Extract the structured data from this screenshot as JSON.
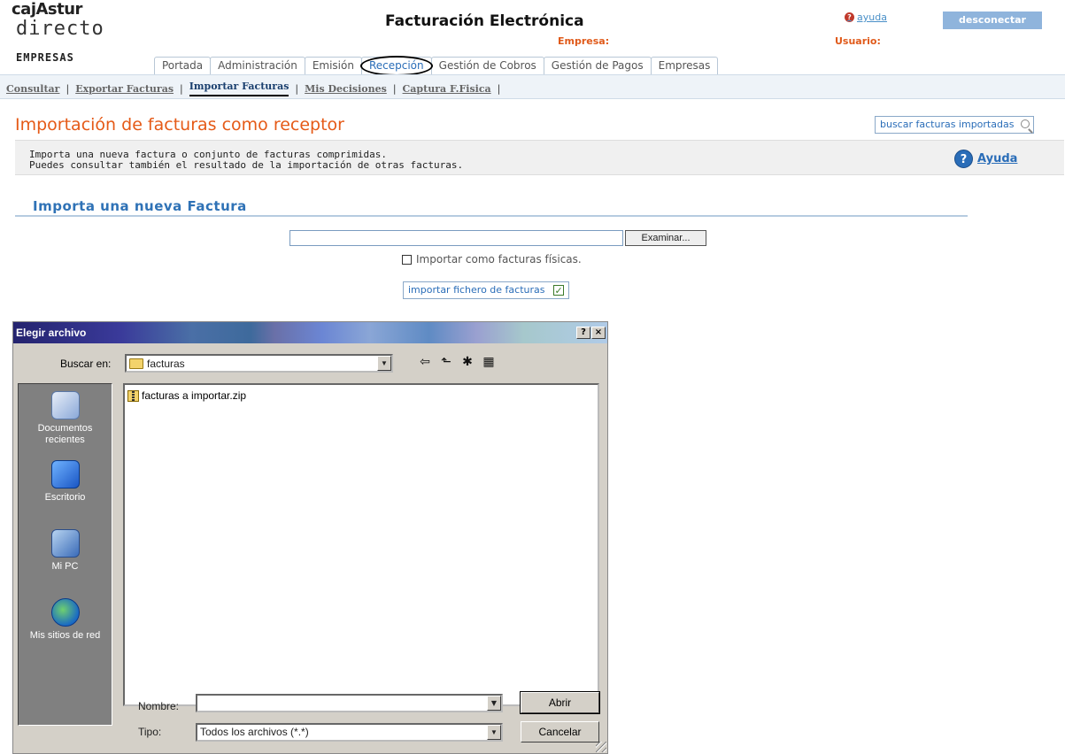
{
  "header": {
    "logo_top": "cajAstur",
    "logo_mid": "directo",
    "logo_bottom": "EMPRESAS",
    "app_title": "Facturación Electrónica",
    "empresa_label": "Empresa:",
    "usuario_label": "Usuario:",
    "help_label": "ayuda",
    "disconnect_label": "desconectar"
  },
  "tabs": [
    {
      "label": "Portada"
    },
    {
      "label": "Administración"
    },
    {
      "label": "Emisión"
    },
    {
      "label": "Recepción",
      "active": true
    },
    {
      "label": "Gestión de Cobros"
    },
    {
      "label": "Gestión de Pagos"
    },
    {
      "label": "Empresas"
    }
  ],
  "subnav": [
    {
      "label": "Consultar"
    },
    {
      "label": "Exportar Facturas"
    },
    {
      "label": "Importar Facturas",
      "active": true
    },
    {
      "label": "Mis Decisiones"
    },
    {
      "label": "Captura F.Fisica"
    }
  ],
  "main": {
    "page_title": "Importación de facturas como receptor",
    "search_imported_label": "buscar facturas importadas",
    "info_line_1": "Importa una nueva factura o conjunto de facturas comprimidas.",
    "info_line_2": "Puedes consultar también el resultado de la importación de otras facturas.",
    "ayuda_label": "Ayuda",
    "section_title": "Importa una nueva Factura",
    "file_input_value": "",
    "browse_label": "Examinar...",
    "checkbox_label": "Importar como facturas físicas.",
    "import_button_label": "importar fichero de facturas"
  },
  "dialog": {
    "title": "Elegir archivo",
    "help_btn": "?",
    "close_btn": "×",
    "look_in_label": "Buscar en:",
    "look_in_value": "facturas",
    "places": [
      {
        "label_1": "Documentos",
        "label_2": "recientes",
        "icon": "recent-documents-icon"
      },
      {
        "label_1": "Escritorio",
        "label_2": "",
        "icon": "desktop-icon"
      },
      {
        "label_1": "Mi PC",
        "label_2": "",
        "icon": "my-computer-icon"
      },
      {
        "label_1": "Mis sitios de red",
        "label_2": "",
        "icon": "network-places-icon"
      }
    ],
    "files": [
      {
        "name": "facturas a importar.zip",
        "icon": "zip-folder-icon"
      }
    ],
    "name_label": "Nombre:",
    "name_value": "",
    "type_label": "Tipo:",
    "type_value": "Todos los archivos (*.*)",
    "open_label": "Abrir",
    "cancel_label": "Cancelar"
  }
}
